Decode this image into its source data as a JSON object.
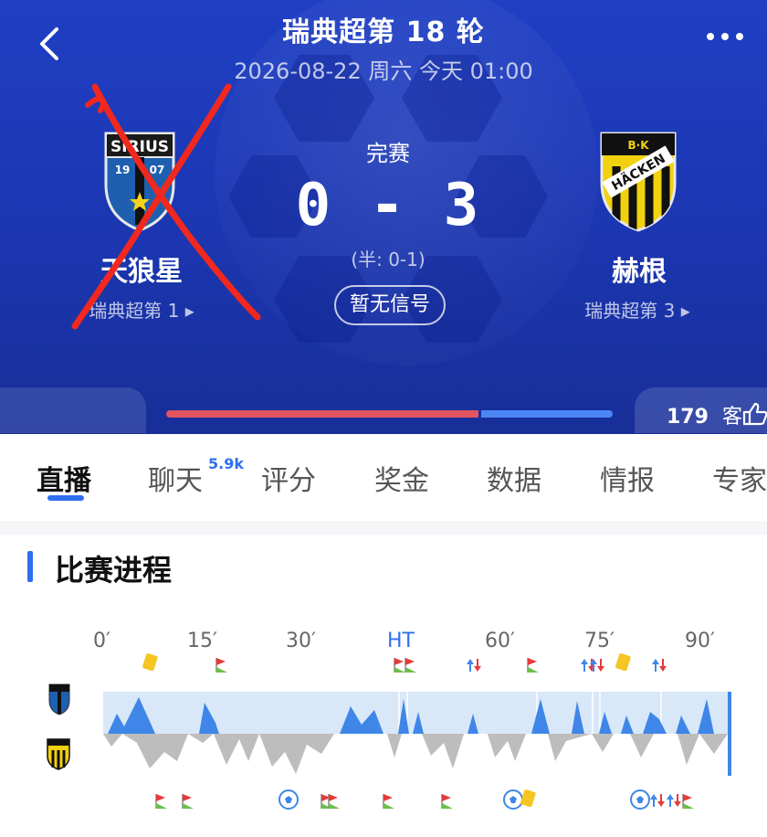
{
  "header": {
    "title": "瑞典超第 18 轮",
    "subtitle": "2026-08-22 周六 今天 01:00"
  },
  "match": {
    "status": "完赛",
    "score": "0 - 3",
    "half_time": "(半: 0-1)",
    "signal_button": "暂无信号",
    "home": {
      "name": "天狼星",
      "rank": "瑞典超第 1 ▸",
      "crest_text": "SIRIUS",
      "crest_year_left": "19",
      "crest_year_right": "07"
    },
    "away": {
      "name": "赫根",
      "rank": "瑞典超第 3 ▸",
      "crest_text": "HÄCKEN",
      "crest_top": "B·K"
    }
  },
  "stats_bar": {
    "viewers_count": "179",
    "viewers_label": "客"
  },
  "tabs": {
    "items": [
      "直播",
      "聊天",
      "评分",
      "奖金",
      "数据",
      "情报",
      "专家"
    ],
    "chat_badge": "5.9k",
    "active": "直播"
  },
  "timeline": {
    "section_title": "比赛进程",
    "labels": [
      "0′",
      "15′",
      "30′",
      "HT",
      "60′",
      "75′",
      "90′"
    ],
    "colors": {
      "home_fill": "#3f86e8",
      "home_band": "#d8e8f9",
      "away_fill": "#bdbdbd",
      "brand": "#2f6ff0"
    }
  },
  "colors": {
    "hero": "#1d3ab8",
    "bar_home": "#e0555f",
    "bar_away": "#4b86f5"
  }
}
